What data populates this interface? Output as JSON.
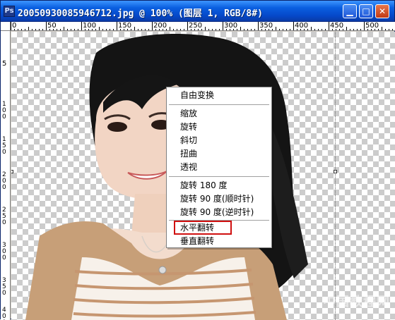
{
  "window": {
    "title": "20050930085946712.jpg @ 100% (图层 1, RGB/8#)",
    "app_icon": "Ps",
    "buttons": {
      "minimize_icon": "minimize-icon",
      "maximize_icon": "maximize-icon",
      "close_icon": "close-icon",
      "minimize_glyph": "▁",
      "maximize_glyph": "□",
      "close_glyph": "✕"
    }
  },
  "ruler": {
    "top_labels": [
      "0",
      "50",
      "100",
      "150",
      "200",
      "250",
      "300",
      "350",
      "400",
      "450",
      "500"
    ],
    "left_labels": [
      "5",
      "1 0 0",
      "1 5 0",
      "2 0 0",
      "2 5 0",
      "3 0 0",
      "3 5 0",
      "4 0 0"
    ]
  },
  "canvas": {
    "watermark": "中国教程网"
  },
  "context_menu": {
    "sections": [
      [
        {
          "label": "自由变换"
        }
      ],
      [
        {
          "label": "缩放"
        },
        {
          "label": "旋转"
        },
        {
          "label": "斜切"
        },
        {
          "label": "扭曲"
        },
        {
          "label": "透视"
        }
      ],
      [
        {
          "label": "旋转 180 度"
        },
        {
          "label": "旋转 90 度(顺时针)"
        },
        {
          "label": "旋转 90 度(逆时针)"
        }
      ],
      [
        {
          "label": "水平翻转"
        },
        {
          "label": "垂直翻转"
        }
      ]
    ],
    "highlighted_item": "水平翻转",
    "highlight_color": "#d01010"
  }
}
